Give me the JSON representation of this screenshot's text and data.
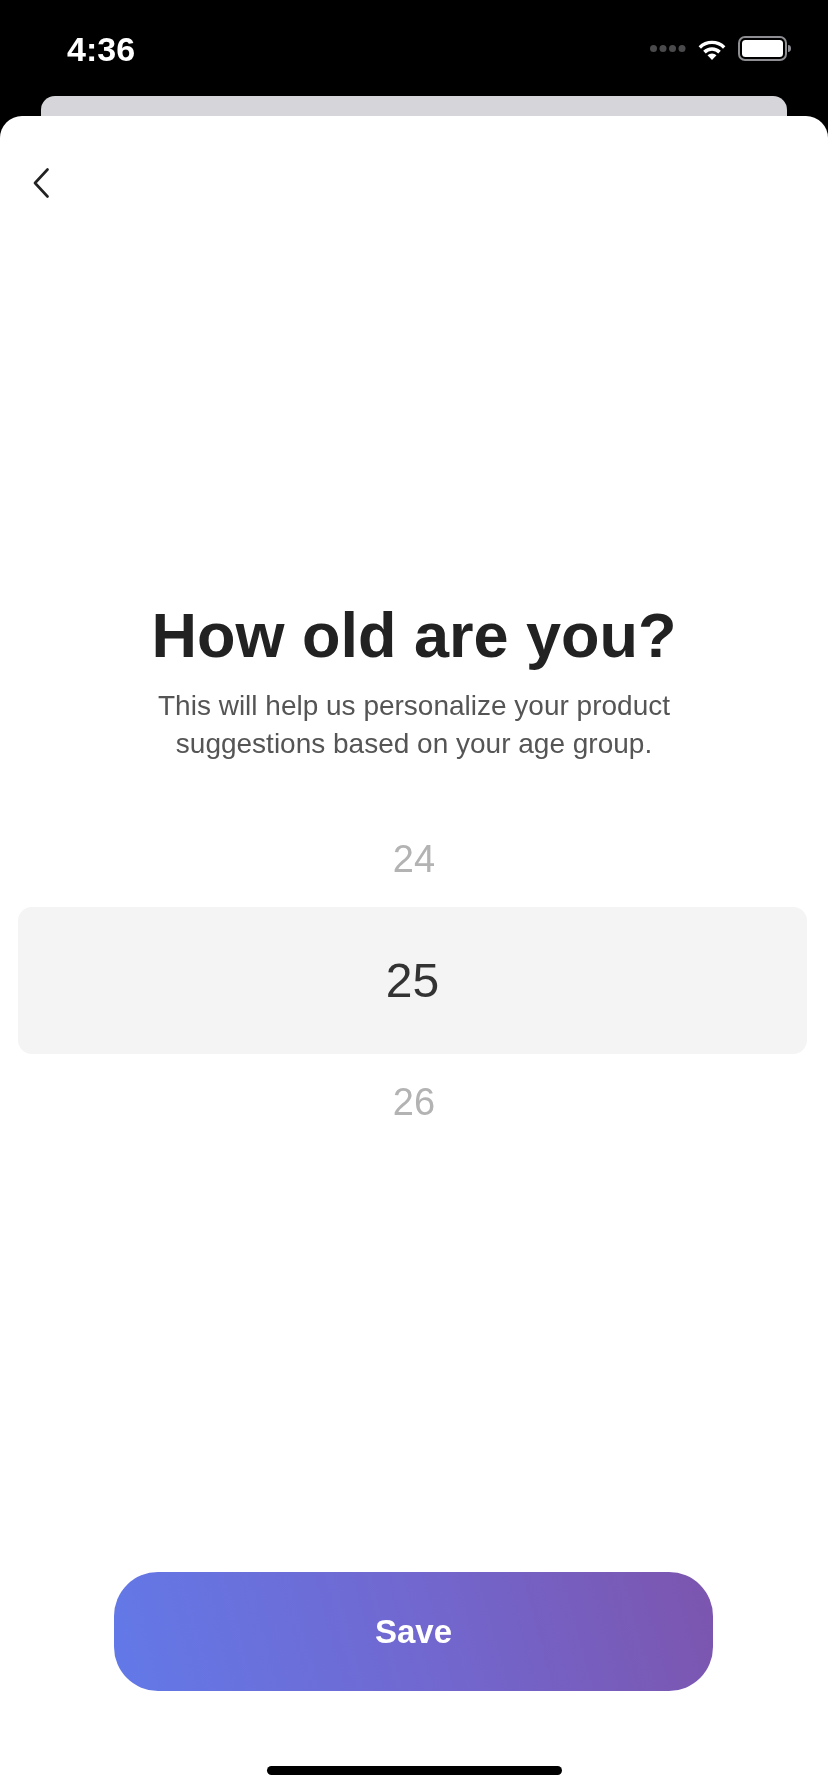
{
  "status_bar": {
    "time": "4:36"
  },
  "question": {
    "title": "How old are you?",
    "subtitle": "This will help us personalize your product suggestions based on your age group."
  },
  "age_picker": {
    "options": [
      {
        "label": "24",
        "selected": false
      },
      {
        "label": "25",
        "selected": true
      },
      {
        "label": "26",
        "selected": false
      }
    ]
  },
  "save_button": {
    "label": "Save"
  }
}
